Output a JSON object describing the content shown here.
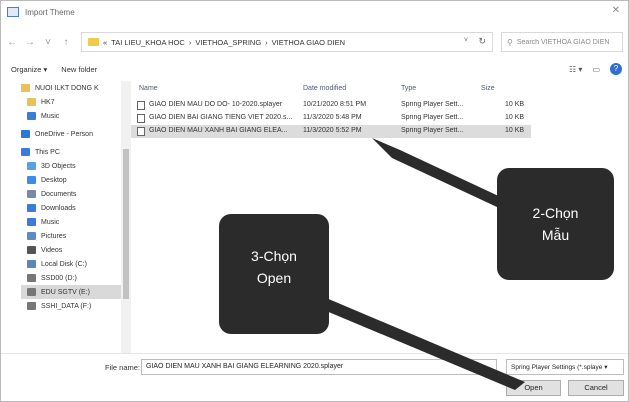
{
  "window": {
    "title": "Import Theme"
  },
  "nav": {
    "back": "←",
    "forward": "→",
    "up": "↑",
    "path": [
      "«",
      "TAI LIEU_KHOA HOC",
      "›",
      "VIETHOA_SPRING",
      "›",
      "VIETHOA GIAO DIEN"
    ],
    "refresh": "↻",
    "search_placeholder": "Search VIETHOA GIAO DIEN"
  },
  "toolbar": {
    "organize": "Organize ▾",
    "new_folder": "New folder",
    "view": "☷ ▾",
    "pane": "▭",
    "help": "?"
  },
  "sidebar": {
    "items": [
      {
        "label": "NUOI ILKT DONG K",
        "icon": "folder-icon",
        "color": "#e8c157"
      },
      {
        "label": "HK7",
        "icon": "folder-icon",
        "color": "#e8c157"
      },
      {
        "label": "Music",
        "icon": "music-icon",
        "color": "#3b7bd9"
      },
      {
        "label": "OneDrive - Person",
        "icon": "cloud-icon",
        "color": "#2b79d6"
      },
      {
        "label": "This PC",
        "icon": "pc-icon",
        "color": "#3b7bd9"
      },
      {
        "label": "3D Objects",
        "icon": "cube-icon",
        "color": "#5aa0e6"
      },
      {
        "label": "Desktop",
        "icon": "desktop-icon",
        "color": "#3b8ee8"
      },
      {
        "label": "Documents",
        "icon": "document-icon",
        "color": "#7a8aa5"
      },
      {
        "label": "Downloads",
        "icon": "download-icon",
        "color": "#3b7bd9"
      },
      {
        "label": "Music",
        "icon": "music-icon",
        "color": "#3b7bd9"
      },
      {
        "label": "Pictures",
        "icon": "picture-icon",
        "color": "#5b8cc8"
      },
      {
        "label": "Videos",
        "icon": "video-icon",
        "color": "#555555"
      },
      {
        "label": "Local Disk (C:)",
        "icon": "drive-icon",
        "color": "#5b86b8"
      },
      {
        "label": "SSD00 (D:)",
        "icon": "drive-icon",
        "color": "#777777"
      },
      {
        "label": "EDU SGTV (E:)",
        "icon": "drive-icon",
        "color": "#777777"
      },
      {
        "label": "SSHI_DATA (F:)",
        "icon": "drive-icon",
        "color": "#777777"
      }
    ]
  },
  "columns": {
    "name": "Name",
    "date": "Date modified",
    "type": "Type",
    "size": "Size"
  },
  "files": [
    {
      "name": "GIAO DIEN MAU DO DO- 10-2020.splayer",
      "date": "10/21/2020 8:51 PM",
      "type": "Spring Player Sett...",
      "size": "10 KB"
    },
    {
      "name": "GIAO DIEN BAI GIANG TIENG VIET 2020.s...",
      "date": "11/3/2020 5:48 PM",
      "type": "Spring Player Sett...",
      "size": "10 KB"
    },
    {
      "name": "GIAO DIEN MAU XANH BAI GIANG ELEA...",
      "date": "11/3/2020 5:52 PM",
      "type": "Spring Player Sett...",
      "size": "10 KB"
    }
  ],
  "bottom": {
    "filename_label": "File name:",
    "filename_value": "GIAO DIEN MAU XANH BAI GIANG ELEARNING 2020.splayer",
    "filter": "Spring Player Settings (*.splaye ▾",
    "open": "Open",
    "cancel": "Cancel"
  },
  "callouts": {
    "step2_line1": "2-Chọn",
    "step2_line2": "Mẫu",
    "step3_line1": "3-Chọn",
    "step3_line2": "Open"
  }
}
